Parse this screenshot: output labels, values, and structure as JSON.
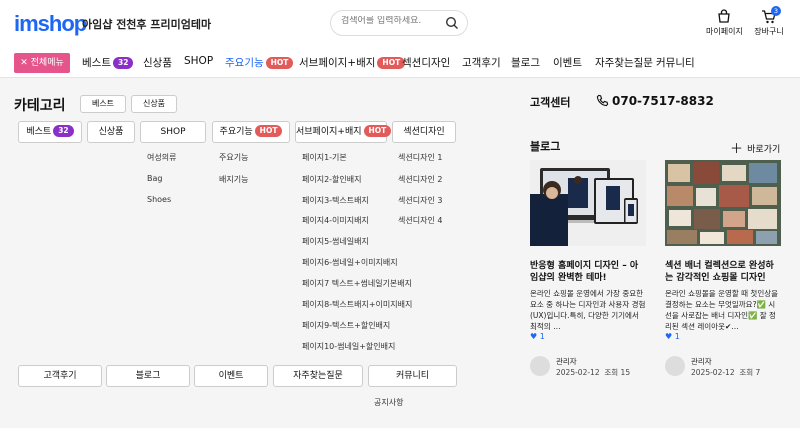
{
  "header": {
    "logo": "imshop",
    "tagline": "아임샵 전천후 프리미엄테마",
    "search_placeholder": "검색어를 입력하세요.",
    "mypage_label": "마이페이지",
    "cart_label": "장바구니",
    "cart_count": "3"
  },
  "nav": {
    "all_menu": "전체메뉴",
    "items": [
      {
        "label": "베스트",
        "badge": "32"
      },
      {
        "label": "신상품"
      },
      {
        "label": "SHOP"
      },
      {
        "label": "주요기능",
        "badge": "HOT"
      },
      {
        "label": "서브페이지+배지",
        "badge": "HOT"
      },
      {
        "label": "섹션디자인"
      },
      {
        "label": "고객후기"
      },
      {
        "label": "블로그"
      },
      {
        "label": "이벤트"
      },
      {
        "label": "자주찾는질문"
      },
      {
        "label": "커뮤니티"
      }
    ]
  },
  "category": {
    "title": "카테고리",
    "tabs": [
      "베스트",
      "신상품"
    ],
    "boxes": [
      {
        "label": "베스트",
        "badge": "32"
      },
      {
        "label": "신상품"
      },
      {
        "label": "SHOP"
      },
      {
        "label": "주요기능",
        "badge": "HOT"
      },
      {
        "label": "서브페이지+배지",
        "badge": "HOT"
      },
      {
        "label": "섹션디자인"
      }
    ],
    "shop_sub": [
      "여성의류",
      "Bag",
      "Shoes"
    ],
    "feature_sub": [
      "주요기능",
      "배지기능"
    ],
    "subpage_sub": [
      "페이지1-기본",
      "페이지2-할인배지",
      "페이지3-텍스트배지",
      "페이지4-이미지배지",
      "페이지5-썸네일배지",
      "페이지6-썸네일+이미지배지",
      "페이지7 텍스트+썸네일기본배지",
      "페이지8-텍스트배지+이미지배지",
      "페이지9-텍스트+할인배지",
      "페이지10-썸네일+할인배지"
    ],
    "section_sub": [
      "섹션디자인 1",
      "섹션디자인 2",
      "섹션디자인 3",
      "섹션디자인 4"
    ],
    "bottom": [
      "고객후기",
      "블로그",
      "이벤트",
      "자주찾는질문",
      "커뮤니티"
    ],
    "notice": "공지사항"
  },
  "cs": {
    "title": "고객센터",
    "phone": "070-7517-8832"
  },
  "blog": {
    "title": "블로그",
    "more": "바로가기",
    "posts": [
      {
        "title": "반응형 홈페이지 디자인 – 아임샵의 완벽한 테마!",
        "desc": "온라인 쇼핑몰 운영에서 가장 중요한 요소 중 하나는 디자인과 사용자 경험(UX)입니다.특히, 다양한 기기에서 최적의 …",
        "likes": "1",
        "author": "관리자",
        "date": "2025-02-12",
        "views": "조회 15"
      },
      {
        "title": "섹션 배너 컬렉션으로 완성하는 감각적인 쇼핑몰 디자인",
        "desc": "온라인 쇼핑몰을 운영할 때 첫인상을 결정하는 요소는 무엇일까요?✅ 시선을 사로잡는 배너 디자인✅ 잘 정리된 섹션 레이아웃✔…",
        "likes": "1",
        "author": "관리자",
        "date": "2025-02-12",
        "views": "조회 7"
      }
    ]
  },
  "colors": {
    "brand": "#1e66f5",
    "menu_pink": "#e6548c",
    "badge_purple": "#8b2fc9",
    "badge_red": "#e15b5b"
  }
}
